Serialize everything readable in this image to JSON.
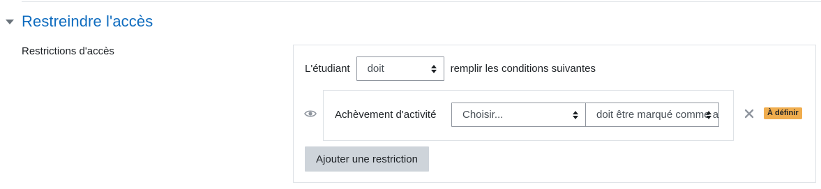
{
  "section": {
    "title": "Restreindre l'accès",
    "expanded": true
  },
  "field": {
    "label": "Restrictions d'accès"
  },
  "restriction": {
    "student_prefix": "L'étudiant",
    "requirement_select": "doit",
    "student_suffix": "remplir les conditions suivantes",
    "condition": {
      "visibility_icon": "eye-icon",
      "type_label": "Achèvement d'activité",
      "activity_select": "Choisir...",
      "state_select": "doit être marqué comme achevé",
      "delete_icon": "close-icon",
      "badge": "À définir",
      "badge_color": "#f0ad4e"
    },
    "add_button": "Ajouter une restriction"
  },
  "colors": {
    "accent": "#0f6cbf",
    "button_bg": "#ced4da",
    "border": "#dee2e6"
  }
}
